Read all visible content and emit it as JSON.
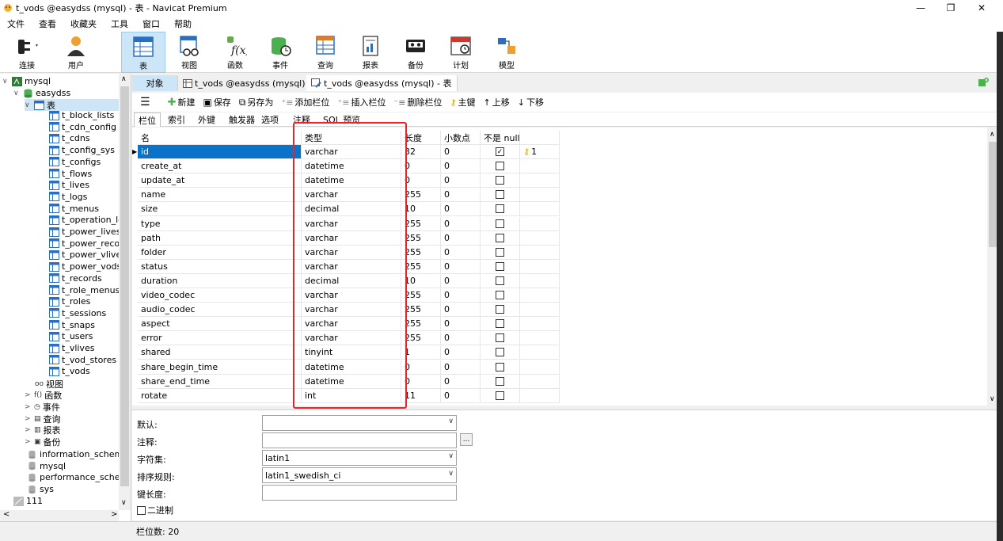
{
  "window": {
    "title": "t_vods @easydss (mysql) - 表 - Navicat Premium",
    "minimize": "—",
    "maximize": "❐",
    "close": "✕"
  },
  "menu": [
    "文件",
    "查看",
    "收藏夹",
    "工具",
    "窗口",
    "帮助"
  ],
  "toolbar": [
    {
      "label": "连接",
      "icon": "connection-icon"
    },
    {
      "label": "用户",
      "icon": "user-icon"
    },
    {
      "label": "表",
      "icon": "table-icon"
    },
    {
      "label": "视图",
      "icon": "view-icon"
    },
    {
      "label": "函数",
      "icon": "function-icon"
    },
    {
      "label": "事件",
      "icon": "event-icon"
    },
    {
      "label": "查询",
      "icon": "query-icon"
    },
    {
      "label": "报表",
      "icon": "report-icon"
    },
    {
      "label": "备份",
      "icon": "backup-icon"
    },
    {
      "label": "计划",
      "icon": "schedule-icon"
    },
    {
      "label": "模型",
      "icon": "model-icon"
    }
  ],
  "tree": {
    "connection": "mysql",
    "database": "easydss",
    "tables_group": "表",
    "tables": [
      "t_block_lists",
      "t_cdn_config",
      "t_cdns",
      "t_config_sys",
      "t_configs",
      "t_flows",
      "t_lives",
      "t_logs",
      "t_menus",
      "t_operation_log",
      "t_power_lives",
      "t_power_record",
      "t_power_vlives",
      "t_power_vods",
      "t_records",
      "t_role_menus",
      "t_roles",
      "t_sessions",
      "t_snaps",
      "t_users",
      "t_vlives",
      "t_vod_stores",
      "t_vods"
    ],
    "groups": [
      "视图",
      "函数",
      "事件",
      "查询",
      "报表",
      "备份"
    ],
    "databases": [
      "information_schema",
      "mysql",
      "performance_schema",
      "sys"
    ],
    "other_connection": "111"
  },
  "tabs": {
    "objects": "对象",
    "tab1": "t_vods @easydss (mysql) - 表",
    "tab2": "t_vods @easydss (mysql) - 表"
  },
  "table_toolbar": {
    "new": "新建",
    "save": "保存",
    "save_as": "另存为",
    "add_field": "添加栏位",
    "insert_field": "插入栏位",
    "delete_field": "删除栏位",
    "primary_key": "主键",
    "move_up": "上移",
    "move_down": "下移"
  },
  "subtabs": [
    "栏位",
    "索引",
    "外键",
    "触发器",
    "选项",
    "注释",
    "SQL 预览"
  ],
  "columns": {
    "name": "名",
    "type": "类型",
    "length": "长度",
    "decimals": "小数点",
    "not_null": "不是 null"
  },
  "fields": [
    {
      "name": "id",
      "type": "varchar",
      "length": "32",
      "decimals": "0",
      "not_null": true,
      "key": "1"
    },
    {
      "name": "create_at",
      "type": "datetime",
      "length": "0",
      "decimals": "0",
      "not_null": false,
      "key": ""
    },
    {
      "name": "update_at",
      "type": "datetime",
      "length": "0",
      "decimals": "0",
      "not_null": false,
      "key": ""
    },
    {
      "name": "name",
      "type": "varchar",
      "length": "255",
      "decimals": "0",
      "not_null": false,
      "key": ""
    },
    {
      "name": "size",
      "type": "decimal",
      "length": "10",
      "decimals": "0",
      "not_null": false,
      "key": ""
    },
    {
      "name": "type",
      "type": "varchar",
      "length": "255",
      "decimals": "0",
      "not_null": false,
      "key": ""
    },
    {
      "name": "path",
      "type": "varchar",
      "length": "255",
      "decimals": "0",
      "not_null": false,
      "key": ""
    },
    {
      "name": "folder",
      "type": "varchar",
      "length": "255",
      "decimals": "0",
      "not_null": false,
      "key": ""
    },
    {
      "name": "status",
      "type": "varchar",
      "length": "255",
      "decimals": "0",
      "not_null": false,
      "key": ""
    },
    {
      "name": "duration",
      "type": "decimal",
      "length": "10",
      "decimals": "0",
      "not_null": false,
      "key": ""
    },
    {
      "name": "video_codec",
      "type": "varchar",
      "length": "255",
      "decimals": "0",
      "not_null": false,
      "key": ""
    },
    {
      "name": "audio_codec",
      "type": "varchar",
      "length": "255",
      "decimals": "0",
      "not_null": false,
      "key": ""
    },
    {
      "name": "aspect",
      "type": "varchar",
      "length": "255",
      "decimals": "0",
      "not_null": false,
      "key": ""
    },
    {
      "name": "error",
      "type": "varchar",
      "length": "255",
      "decimals": "0",
      "not_null": false,
      "key": ""
    },
    {
      "name": "shared",
      "type": "tinyint",
      "length": "1",
      "decimals": "0",
      "not_null": false,
      "key": ""
    },
    {
      "name": "share_begin_time",
      "type": "datetime",
      "length": "0",
      "decimals": "0",
      "not_null": false,
      "key": ""
    },
    {
      "name": "share_end_time",
      "type": "datetime",
      "length": "0",
      "decimals": "0",
      "not_null": false,
      "key": ""
    },
    {
      "name": "rotate",
      "type": "int",
      "length": "11",
      "decimals": "0",
      "not_null": false,
      "key": ""
    }
  ],
  "properties": {
    "default_label": "默认:",
    "default_value": "",
    "comment_label": "注释:",
    "comment_value": "",
    "comment_button": "...",
    "charset_label": "字符集:",
    "charset_value": "latin1",
    "collation_label": "排序规则:",
    "collation_value": "latin1_swedish_ci",
    "key_length_label": "键长度:",
    "key_length_value": "",
    "binary_label": "二进制"
  },
  "status": {
    "field_count": "栏位数: 20"
  },
  "colors": {
    "accent": "#0a72c9",
    "highlight": "#e8232a",
    "selection": "#cde6f7"
  }
}
